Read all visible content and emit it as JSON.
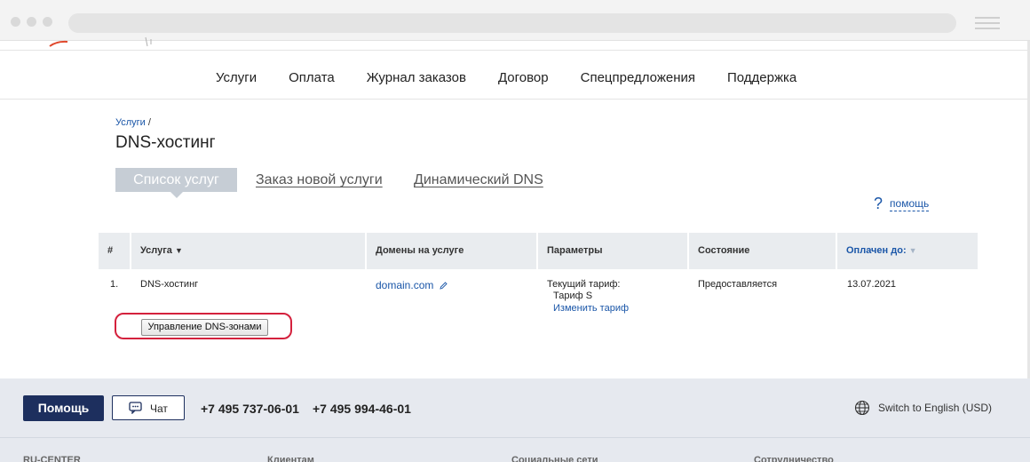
{
  "nav": [
    "Услуги",
    "Оплата",
    "Журнал заказов",
    "Договор",
    "Спецпредложения",
    "Поддержка"
  ],
  "breadcrumb": {
    "link": "Услуги",
    "separator": "/"
  },
  "page_title": "DNS-хостинг",
  "tabs": {
    "active": "Список услуг",
    "order": "Заказ новой услуги",
    "dynamic": "Динамический DNS"
  },
  "help": {
    "icon": "?",
    "label": "помощь"
  },
  "table": {
    "headers": {
      "num": "#",
      "service": "Услуга",
      "domains": "Домены на услуге",
      "params": "Параметры",
      "state": "Состояние",
      "paid": "Оплачен до:"
    },
    "row": {
      "num": "1.",
      "service": "DNS-хостинг",
      "domain": "domain.com",
      "tariff_label": "Текущий тариф:",
      "tariff_value": "Тариф S",
      "change_tariff": "Изменить тариф",
      "state": "Предоставляется",
      "paid_until": "13.07.2021"
    },
    "dns_button": "Управление DNS-зонами"
  },
  "footer": {
    "help_button": "Помощь",
    "chat_button": "Чат",
    "phone1": "+7 495 737-06-01",
    "phone2": "+7 495 994-46-01",
    "language": "Switch to English (USD)",
    "columns": [
      "RU-CENTER",
      "Клиентам",
      "Социальные сети",
      "Сотрудничество"
    ]
  },
  "colors": {
    "accent": "#1a56a8",
    "navy": "#1d2f5e",
    "highlight": "#d4213d",
    "tab_bg": "#c6cdd5"
  }
}
